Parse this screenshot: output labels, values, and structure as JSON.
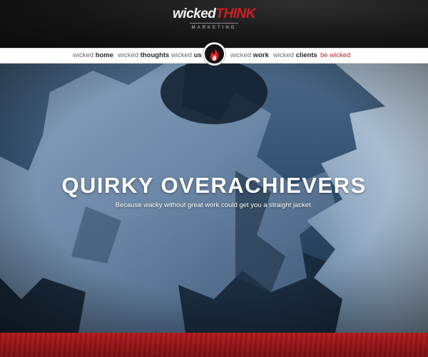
{
  "header": {
    "logo_wicked": "wicked",
    "logo_think": "THINK",
    "logo_sub": "MARKETING"
  },
  "nav": {
    "items": [
      {
        "prefix": "wicked",
        "label": "home"
      },
      {
        "prefix": "wicked",
        "label": "thoughts"
      },
      {
        "prefix": "wicked",
        "label": "us"
      },
      {
        "prefix": "wicked",
        "label": "work"
      },
      {
        "prefix": "wicked",
        "label": "clients"
      },
      {
        "prefix": "be",
        "label": "wicked"
      }
    ],
    "center_icon": "flame-icon"
  },
  "hero": {
    "title": "QUIRKY OVERACHIEVERS",
    "subtitle": "Because wacky without great work could get you a straight jacket."
  },
  "colors": {
    "brand_red": "#c41d1d",
    "header_bg": "#151515",
    "nav_bg": "#ffffff",
    "hero_blue": "#31506f",
    "footer_red": "#a5171a"
  }
}
